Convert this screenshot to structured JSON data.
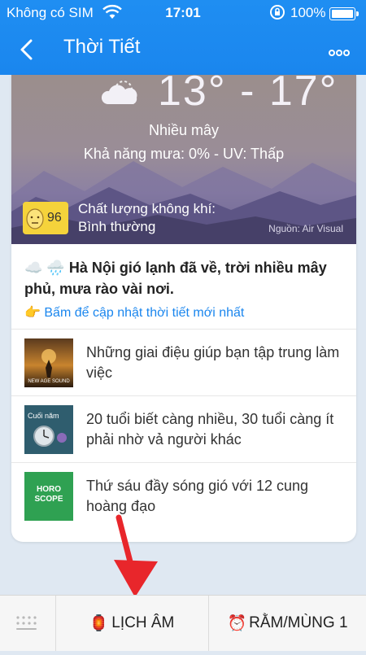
{
  "status_bar": {
    "carrier": "Không có SIM",
    "time": "17:01",
    "battery": "100%"
  },
  "header": {
    "title": "Thời Tiết"
  },
  "weather": {
    "temperature": "13° - 17°",
    "condition": "Nhiều mây",
    "forecast": "Khả năng mưa: 0% - UV: Thấp",
    "air_quality": {
      "index": "96",
      "label": "Chất lượng không khí:",
      "value": "Bình thường",
      "source": "Nguồn: Air Visual"
    }
  },
  "news_headline": {
    "emoji": "☁️ 🌧️",
    "text": "Hà Nội gió lạnh đã về, trời nhiều mây phủ, mưa rào vài nơi.",
    "link_emoji": "👉",
    "link": "Bấm để cập nhật thời tiết mới nhất"
  },
  "articles": [
    {
      "title": "Những giai điệu giúp bạn tập trung làm việc",
      "thumb_text": "NEW AGE SOUND"
    },
    {
      "title": "20 tuổi biết càng nhiều, 30 tuổi càng ít phải nhờ vả người khác",
      "thumb_text": "Cuối năm"
    },
    {
      "title": "Thứ sáu đầy sóng gió với 12 cung hoàng đạo",
      "thumb_text": "HORO SCOPE"
    }
  ],
  "tabbar": {
    "lunar_icon": "🏮",
    "lunar": "LỊCH ÂM",
    "moon_icon": "⏰",
    "moon": "RẰM/MÙNG 1"
  },
  "colors": {
    "header": "#1a86ee",
    "link": "#1a86ee",
    "arrow": "#e8262b",
    "aq_badge": "#f5d33b"
  }
}
